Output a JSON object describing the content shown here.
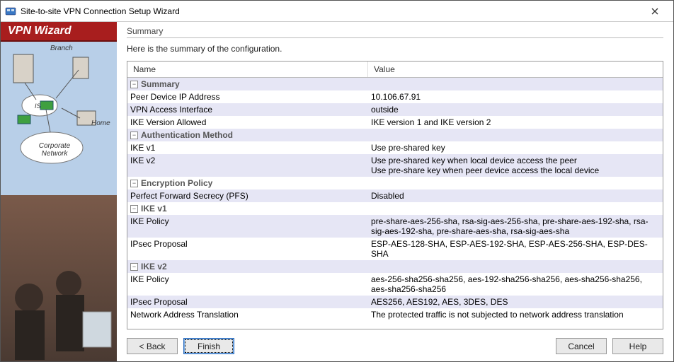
{
  "window": {
    "title": "Site-to-site VPN Connection Setup Wizard"
  },
  "sidebar": {
    "header": "VPN Wizard",
    "labels": {
      "branch": "Branch",
      "isp": "ISP",
      "home": "Home",
      "corp": "Corporate Network"
    }
  },
  "main": {
    "section_title": "Summary",
    "description": "Here is the summary of the configuration.",
    "columns": {
      "name": "Name",
      "value": "Value"
    },
    "rows": [
      {
        "type": "group",
        "indent": 0,
        "label": "Summary",
        "alt": true
      },
      {
        "type": "item",
        "indent": 1,
        "label": "Peer Device IP Address",
        "value": "10.106.67.91",
        "alt": false
      },
      {
        "type": "item",
        "indent": 1,
        "label": "VPN Access Interface",
        "value": "outside",
        "alt": true
      },
      {
        "type": "item",
        "indent": 1,
        "label": "IKE Version Allowed",
        "value": "IKE version 1 and IKE version 2",
        "alt": false
      },
      {
        "type": "group",
        "indent": 1,
        "label": "Authentication Method",
        "alt": true
      },
      {
        "type": "item",
        "indent": 2,
        "label": "IKE v1",
        "value": "Use pre-shared key",
        "alt": false
      },
      {
        "type": "item",
        "indent": 2,
        "label": "IKE v2",
        "value": "Use pre-shared key when local device access the peer\nUse pre-share key when peer device access the local device",
        "alt": true
      },
      {
        "type": "group",
        "indent": 1,
        "label": "Encryption Policy",
        "alt": false
      },
      {
        "type": "item",
        "indent": 2,
        "label": "Perfect Forward Secrecy (PFS)",
        "value": "Disabled",
        "alt": true
      },
      {
        "type": "group",
        "indent": 2,
        "label": "IKE v1",
        "alt": false
      },
      {
        "type": "item",
        "indent": 3,
        "label": "IKE Policy",
        "value": "pre-share-aes-256-sha, rsa-sig-aes-256-sha, pre-share-aes-192-sha, rsa-sig-aes-192-sha, pre-share-aes-sha, rsa-sig-aes-sha",
        "alt": true
      },
      {
        "type": "item",
        "indent": 3,
        "label": "IPsec Proposal",
        "value": "ESP-AES-128-SHA, ESP-AES-192-SHA, ESP-AES-256-SHA, ESP-DES-SHA",
        "alt": false
      },
      {
        "type": "group",
        "indent": 2,
        "label": "IKE v2",
        "alt": true
      },
      {
        "type": "item",
        "indent": 3,
        "label": "IKE Policy",
        "value": "aes-256-sha256-sha256, aes-192-sha256-sha256, aes-sha256-sha256, aes-sha256-sha256",
        "alt": false
      },
      {
        "type": "item",
        "indent": 3,
        "label": "IPsec Proposal",
        "value": "AES256, AES192, AES, 3DES, DES",
        "alt": true
      },
      {
        "type": "item",
        "indent": 1,
        "label": "Network Address Translation",
        "value": "The protected traffic is not subjected to network address translation",
        "alt": false
      }
    ]
  },
  "buttons": {
    "back": "< Back",
    "finish": "Finish",
    "cancel": "Cancel",
    "help": "Help"
  }
}
